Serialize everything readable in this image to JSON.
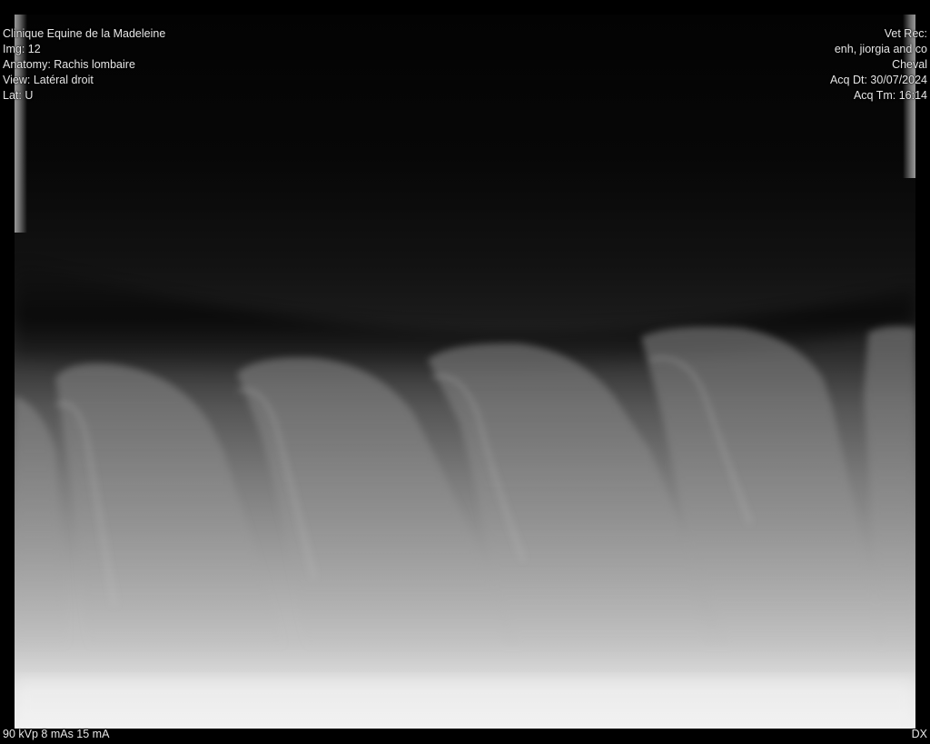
{
  "overlay": {
    "top_left": {
      "clinic": "Clinique Equine de la Madeleine",
      "img": "Img: 12",
      "anatomy": "Anatomy: Rachis lombaire",
      "view": "View: Latéral droit",
      "lat": "Lat: U"
    },
    "top_right": {
      "vet_rec": "Vet Rec:",
      "vet_names": "enh, jiorgia and co",
      "species": "Cheval",
      "acq_date": "Acq Dt: 30/07/2024",
      "acq_time": "Acq Tm: 16:14"
    },
    "bottom_left": {
      "exposure": "90 kVp 8 mAs 15 mA"
    },
    "bottom_right": {
      "modality": "DX"
    }
  }
}
